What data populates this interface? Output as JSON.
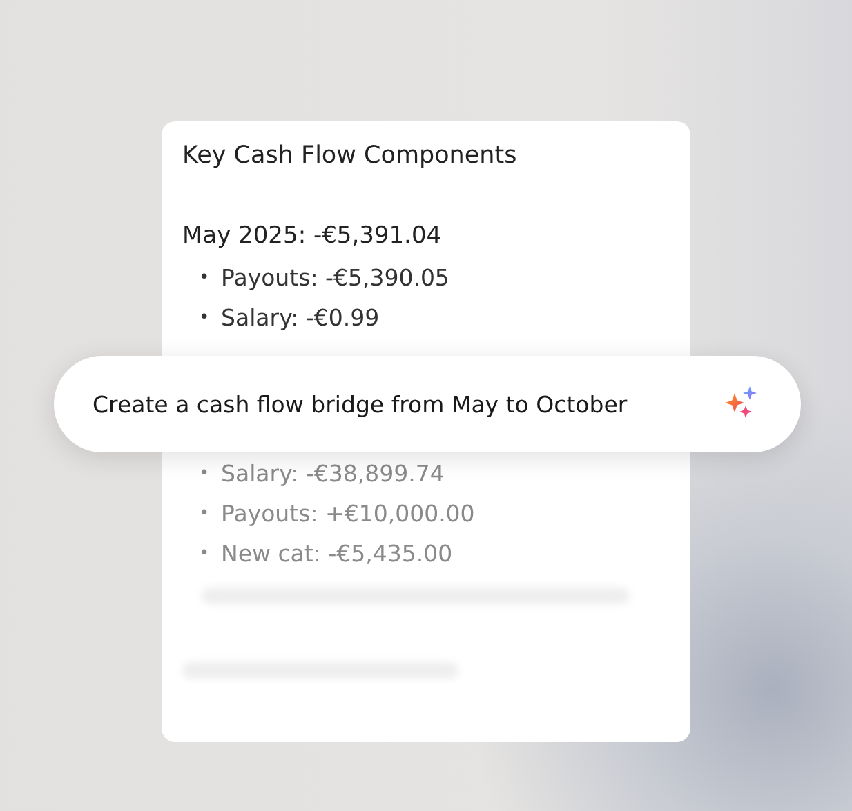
{
  "card": {
    "title": "Key Cash Flow Components",
    "period": "May 2025: -€5,391.04",
    "items": [
      {
        "marker": "•",
        "text": "Payouts: -€5,390.05",
        "faded": false
      },
      {
        "marker": "•",
        "text": "Salary: -€0.99",
        "faded": false
      }
    ],
    "faded_items": [
      {
        "marker": "•",
        "text": "Salary: -€38,899.74",
        "faded": true
      },
      {
        "marker": "•",
        "text": "Payouts: +€10,000.00",
        "faded": true
      },
      {
        "marker": "•",
        "text": "New cat: -€5,435.00",
        "faded": true
      }
    ]
  },
  "prompt": {
    "text": "Create a cash flow bridge from May to October"
  }
}
